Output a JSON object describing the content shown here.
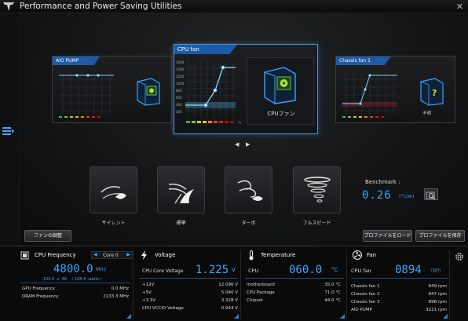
{
  "window": {
    "title": "Performance and Power Saving Utilities",
    "close": "✕"
  },
  "fans": {
    "left": {
      "title": "AIO PUMP"
    },
    "center": {
      "title": "CPU fan",
      "caption": "CPUファン",
      "y_ticks": [
        "1600",
        "1400",
        "1200",
        "1000",
        "800",
        "600",
        "400",
        "200"
      ],
      "x_unit": "°c"
    },
    "right": {
      "title": "Chassis fan 1",
      "caption": "不明"
    }
  },
  "nav": {
    "prev": "◀",
    "next": "▶"
  },
  "modes": [
    {
      "label": "サイレント",
      "icon": "silent-leaf-icon"
    },
    {
      "label": "標準",
      "icon": "standard-wind-icon"
    },
    {
      "label": "ターボ",
      "icon": "turbo-wind-icon"
    },
    {
      "label": "フルスピード",
      "icon": "fullspeed-tornado-icon"
    }
  ],
  "benchmark": {
    "label": "Benchmark :",
    "value": "0.26",
    "unit": "(°c/w)"
  },
  "buttons": {
    "fan_tune": "ファンの調整",
    "load_profile": "プロファイルをロード",
    "save_profile": "プロファイルを保存"
  },
  "status": {
    "cpu_freq": {
      "title": "CPU Frequency",
      "core_select": "Core 0",
      "value": "4800.0",
      "unit": "MHz",
      "sub": "100.0  x  48    ( 108.4  watts )",
      "rows": [
        {
          "label": "GPU Frequency",
          "value": "0.0  MHz"
        },
        {
          "label": "DRAM Frequency",
          "value": "2133.3  MHz"
        }
      ]
    },
    "voltage": {
      "title": "Voltage",
      "main_label": "CPU Core Voltage",
      "value": "1.225",
      "unit": "V",
      "rows": [
        {
          "label": "+12V",
          "value": "12.096  V"
        },
        {
          "label": "+5V",
          "value": "5.040  V"
        },
        {
          "label": "+3.3V",
          "value": "3.328  V"
        },
        {
          "label": "CPU VCCIO Voltage",
          "value": "0.944  V"
        }
      ]
    },
    "temperature": {
      "title": "Temperature",
      "main_label": "CPU",
      "value": "060.0",
      "unit": "°C",
      "rows": [
        {
          "label": "motherboard",
          "value": "35.0  °C"
        },
        {
          "label": "CPU Package",
          "value": "71.0  °C"
        },
        {
          "label": "Chipset",
          "value": "44.0  °C"
        }
      ]
    },
    "fan": {
      "title": "Fan",
      "main_label": "CPU fan",
      "value": "0894",
      "unit": "rpm",
      "rows": [
        {
          "label": "Chassis fan 1",
          "value": "649  rpm"
        },
        {
          "label": "Chassis fan 2",
          "value": "847  rpm"
        },
        {
          "label": "Chassis fan 3",
          "value": "898  rpm"
        },
        {
          "label": "AIO PUMP",
          "value": "3221  rpm"
        }
      ]
    }
  },
  "colors": {
    "accent": "#3aa7ff",
    "header_blue": "#1e5aa6"
  }
}
